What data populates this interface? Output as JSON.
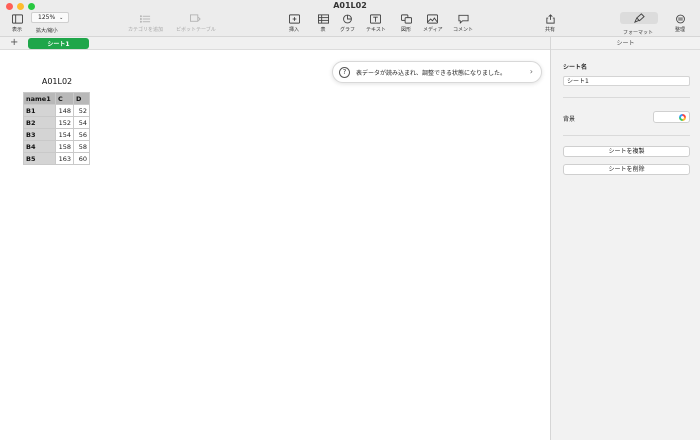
{
  "window": {
    "title": "A01L02"
  },
  "toolbar": {
    "view_label": "表示",
    "zoom_value": "125%",
    "zoom_label": "拡大/縮小",
    "add_category_label": "カテゴリを追加",
    "pivot_table_label": "ピボットテーブル",
    "insert_label": "挿入",
    "table_label": "表",
    "chart_label": "グラフ",
    "text_label": "テキスト",
    "shape_label": "図形",
    "media_label": "メディア",
    "comment_label": "コメント",
    "share_label": "共有",
    "format_label": "フォーマット",
    "organize_label": "整理"
  },
  "sheets": {
    "add_symbol": "+",
    "tabs": [
      {
        "label": "シート1",
        "active": true
      }
    ]
  },
  "table": {
    "title": "A01L02",
    "headers": [
      "name1",
      "C",
      "D"
    ],
    "rows": [
      [
        "B1",
        "148",
        "52"
      ],
      [
        "B2",
        "152",
        "54"
      ],
      [
        "B3",
        "154",
        "56"
      ],
      [
        "B4",
        "158",
        "58"
      ],
      [
        "B5",
        "163",
        "60"
      ]
    ]
  },
  "notice": {
    "icon": "question-icon",
    "text": "表データが読み込まれ、調整できる状態になりました。"
  },
  "inspector": {
    "header": "シート",
    "sheet_name_label": "シート名",
    "sheet_name_value": "シート1",
    "background_label": "背景",
    "duplicate_button": "シートを複製",
    "delete_button": "シートを削除"
  },
  "colors": {
    "accent_green": "#1fa64a",
    "toolbar_bg": "#ececec",
    "inspector_bg": "#f2f2f2"
  }
}
